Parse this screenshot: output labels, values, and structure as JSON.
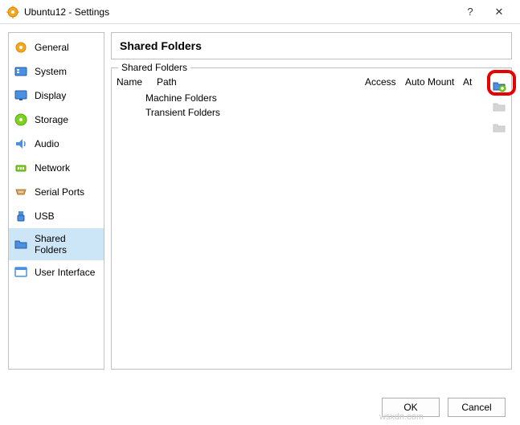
{
  "window": {
    "title": "Ubuntu12 - Settings",
    "help_icon": "?",
    "close_icon": "✕"
  },
  "sidebar": {
    "items": [
      {
        "id": "general",
        "label": "General"
      },
      {
        "id": "system",
        "label": "System"
      },
      {
        "id": "display",
        "label": "Display"
      },
      {
        "id": "storage",
        "label": "Storage"
      },
      {
        "id": "audio",
        "label": "Audio"
      },
      {
        "id": "network",
        "label": "Network"
      },
      {
        "id": "serial-ports",
        "label": "Serial Ports"
      },
      {
        "id": "usb",
        "label": "USB"
      },
      {
        "id": "shared-folders",
        "label": "Shared Folders"
      },
      {
        "id": "user-interface",
        "label": "User Interface"
      }
    ],
    "selected": "shared-folders"
  },
  "page": {
    "title": "Shared Folders",
    "group_label": "Shared Folders",
    "columns": {
      "name": "Name",
      "path": "Path",
      "access": "Access",
      "automount": "Auto Mount",
      "at": "At"
    },
    "rows": [
      {
        "label": "Machine Folders"
      },
      {
        "label": "Transient Folders"
      }
    ]
  },
  "buttons": {
    "ok": "OK",
    "cancel": "Cancel"
  },
  "watermark": "wsxdn.com"
}
